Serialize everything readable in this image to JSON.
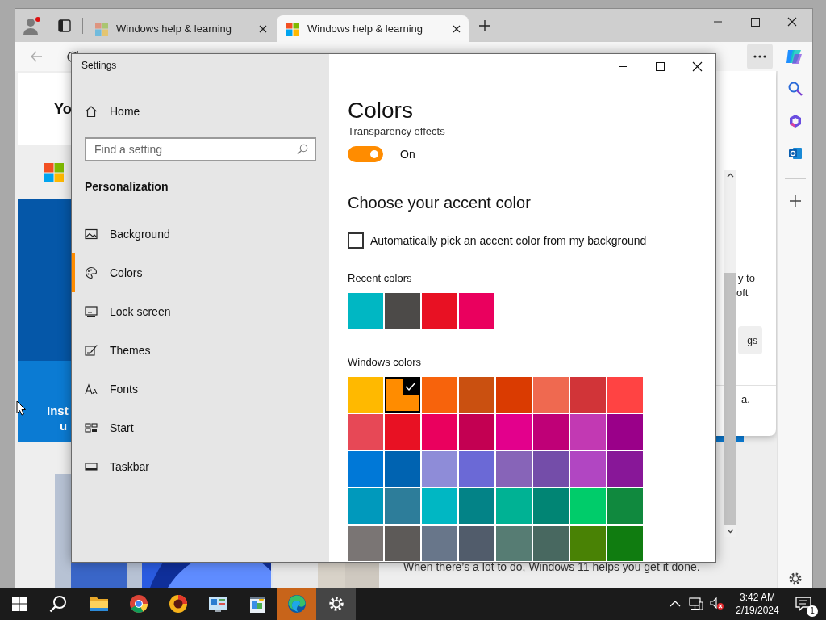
{
  "browser": {
    "tabs": [
      {
        "title": "Windows help & learning",
        "selected": false
      },
      {
        "title": "Windows help & learning",
        "selected": true
      }
    ],
    "page": {
      "card_text": "Yo",
      "banner_lines": [
        "Inst",
        "u"
      ],
      "body_text": "When there’s a lot to do, Windows 11 helps you get it done."
    },
    "popup": {
      "lines": [
        "y to",
        "oft"
      ],
      "button": "gs",
      "note": "a."
    }
  },
  "settings": {
    "title": "Settings",
    "home": "Home",
    "search": {
      "placeholder": "Find a setting"
    },
    "section": "Personalization",
    "nav": [
      {
        "label": "Background",
        "kind": "background",
        "selected": false
      },
      {
        "label": "Colors",
        "kind": "colors",
        "selected": true
      },
      {
        "label": "Lock screen",
        "kind": "lock",
        "selected": false
      },
      {
        "label": "Themes",
        "kind": "themes",
        "selected": false
      },
      {
        "label": "Fonts",
        "kind": "fonts",
        "selected": false
      },
      {
        "label": "Start",
        "kind": "start",
        "selected": false
      },
      {
        "label": "Taskbar",
        "kind": "taskbar",
        "selected": false
      }
    ],
    "page_title": "Colors",
    "transparency": {
      "label": "Transparency effects",
      "on": true,
      "state_text": "On"
    },
    "accent_heading": "Choose your accent color",
    "auto_pick": {
      "label": "Automatically pick an accent color from my background",
      "checked": false
    },
    "recent_label": "Recent colors",
    "recent_colors": [
      {
        "color": "#00b7c3",
        "selected": false
      },
      {
        "color": "#4c4a48",
        "selected": false
      },
      {
        "color": "#e81123",
        "selected": false
      },
      {
        "color": "#ea005e",
        "selected": false
      }
    ],
    "windows_label": "Windows colors",
    "windows_colors": [
      {
        "color": "#ffb900",
        "selected": false
      },
      {
        "color": "#ff8c00",
        "selected": true
      },
      {
        "color": "#f7630c",
        "selected": false
      },
      {
        "color": "#ca5010",
        "selected": false
      },
      {
        "color": "#da3b01",
        "selected": false
      },
      {
        "color": "#ef6950",
        "selected": false
      },
      {
        "color": "#d13438",
        "selected": false
      },
      {
        "color": "#ff4343",
        "selected": false
      },
      {
        "color": "#e74856",
        "selected": false
      },
      {
        "color": "#e81123",
        "selected": false
      },
      {
        "color": "#ea005e",
        "selected": false
      },
      {
        "color": "#c30052",
        "selected": false
      },
      {
        "color": "#e3008c",
        "selected": false
      },
      {
        "color": "#bf0077",
        "selected": false
      },
      {
        "color": "#c239b3",
        "selected": false
      },
      {
        "color": "#9a0089",
        "selected": false
      },
      {
        "color": "#0078d7",
        "selected": false
      },
      {
        "color": "#0063b1",
        "selected": false
      },
      {
        "color": "#8e8cd8",
        "selected": false
      },
      {
        "color": "#6b69d6",
        "selected": false
      },
      {
        "color": "#8764b8",
        "selected": false
      },
      {
        "color": "#744da9",
        "selected": false
      },
      {
        "color": "#b146c2",
        "selected": false
      },
      {
        "color": "#881798",
        "selected": false
      },
      {
        "color": "#0099bc",
        "selected": false
      },
      {
        "color": "#2d7d9a",
        "selected": false
      },
      {
        "color": "#00b7c3",
        "selected": false
      },
      {
        "color": "#038387",
        "selected": false
      },
      {
        "color": "#00b294",
        "selected": false
      },
      {
        "color": "#018574",
        "selected": false
      },
      {
        "color": "#00cc6a",
        "selected": false
      },
      {
        "color": "#10893e",
        "selected": false
      },
      {
        "color": "#7a7574",
        "selected": false
      },
      {
        "color": "#5d5a58",
        "selected": false
      },
      {
        "color": "#68768a",
        "selected": false
      },
      {
        "color": "#515c6b",
        "selected": false
      },
      {
        "color": "#567c73",
        "selected": false
      },
      {
        "color": "#486860",
        "selected": false
      },
      {
        "color": "#498205",
        "selected": false
      },
      {
        "color": "#107c10",
        "selected": false
      }
    ]
  },
  "taskbar": {
    "apps": [
      {
        "kind": "start",
        "flashing": false,
        "active": false
      },
      {
        "kind": "search",
        "flashing": false,
        "active": false
      },
      {
        "kind": "explorer",
        "flashing": false,
        "active": false
      },
      {
        "kind": "chrome",
        "flashing": false,
        "active": false
      },
      {
        "kind": "ring-browser",
        "flashing": false,
        "active": false
      },
      {
        "kind": "control-panel",
        "flashing": false,
        "active": false
      },
      {
        "kind": "paint",
        "flashing": false,
        "active": false
      },
      {
        "kind": "edge",
        "flashing": true,
        "active": false
      },
      {
        "kind": "settings",
        "flashing": false,
        "active": true
      }
    ],
    "time": "3:42 AM",
    "date": "2/19/2024",
    "notifications": "1"
  }
}
